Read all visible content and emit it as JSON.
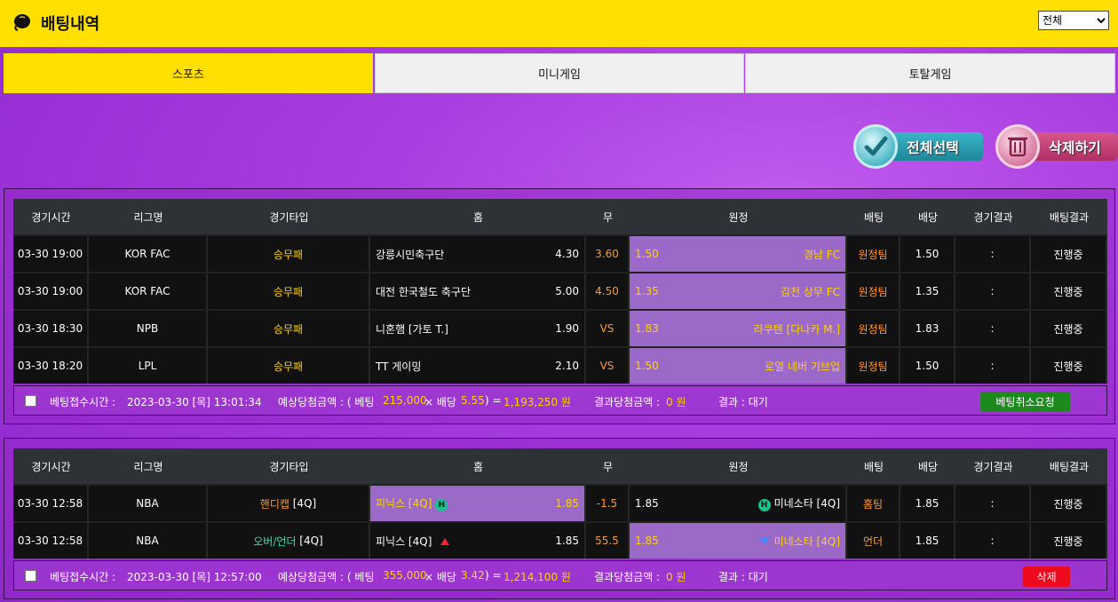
{
  "header": {
    "title": "배팅내역",
    "filter_selected": "전체"
  },
  "tabs": [
    "스포츠",
    "미니게임",
    "토탈게임"
  ],
  "actions": {
    "select_all": "전체선택",
    "delete": "삭제하기"
  },
  "columns": [
    "경기시간",
    "리그명",
    "경기타입",
    "홈",
    "무",
    "원정",
    "배팅",
    "배당",
    "경기결과",
    "배팅결과"
  ],
  "bets": [
    {
      "rows": [
        {
          "time": "03-30 19:00",
          "league": "KOR FAC",
          "type": "승무패",
          "type_extra": "",
          "home": "강릉시민축구단",
          "home_odds": "4.30",
          "draw": "3.60",
          "away_odds": "1.50",
          "away": "경남 FC",
          "pick": "원정팀",
          "odds": "1.50",
          "score": ":",
          "result": "진행중"
        },
        {
          "time": "03-30 19:00",
          "league": "KOR FAC",
          "type": "승무패",
          "type_extra": "",
          "home": "대전 한국철도 축구단",
          "home_odds": "5.00",
          "draw": "4.50",
          "away_odds": "1.35",
          "away": "김천 상무 FC",
          "pick": "원정팀",
          "odds": "1.35",
          "score": ":",
          "result": "진행중"
        },
        {
          "time": "03-30 18:30",
          "league": "NPB",
          "type": "승무패",
          "type_extra": "",
          "home": "니혼햄 [가토 T.]",
          "home_odds": "1.90",
          "draw": "VS",
          "away_odds": "1.83",
          "away": "라쿠텐 [다나카 M.]",
          "pick": "원정팀",
          "odds": "1.83",
          "score": ":",
          "result": "진행중"
        },
        {
          "time": "03-30 18:20",
          "league": "LPL",
          "type": "승무패",
          "type_extra": "",
          "home": "TT 게이밍",
          "home_odds": "2.10",
          "draw": "VS",
          "away_odds": "1.50",
          "away": "로열 네버 기브업",
          "pick": "원정팀",
          "odds": "1.50",
          "score": ":",
          "result": "진행중"
        }
      ],
      "summary": {
        "time_label": "베팅접수시간 :",
        "time": "2023-03-30 [목] 13:01:34",
        "expected_label": "예상당첨금액 : ( 베팅",
        "stake": "215,000",
        "times": "× 배당",
        "total_odds": "5.55",
        "eq": ") =",
        "expected": "1,193,250 원",
        "win_label": "결과당첨금액 :",
        "win": "0 원",
        "result_label": "결과 : 대기",
        "button": "베팅취소요청"
      }
    },
    {
      "rows": [
        {
          "time": "03-30 12:58",
          "league": "NBA",
          "type": "핸디캡",
          "type_extra": "[4Q]",
          "home": "피닉스 [4Q]",
          "home_odds": "1.85",
          "draw": "-1.5",
          "away_odds": "1.85",
          "away": "미네소타 [4Q]",
          "pick": "홈팀",
          "odds": "1.85",
          "score": ":",
          "result": "진행중"
        },
        {
          "time": "03-30 12:58",
          "league": "NBA",
          "type": "오버/언더",
          "type_extra": "[4Q]",
          "home": "피닉스 [4Q]",
          "home_odds": "1.85",
          "draw": "55.5",
          "away_odds": "1.85",
          "away": "미네소타 [4Q]",
          "pick": "언더",
          "odds": "1.85",
          "score": ":",
          "result": "진행중"
        }
      ],
      "summary": {
        "time_label": "베팅접수시간 :",
        "time": "2023-03-30 [목] 12:57:00",
        "expected_label": "예상당첨금액 : ( 베팅",
        "stake": "355,000",
        "times": "× 배당",
        "total_odds": "3.42",
        "eq": ") =",
        "expected": "1,214,100 원",
        "win_label": "결과당첨금액 :",
        "win": "0 원",
        "result_label": "결과 : 대기",
        "button": "삭제"
      }
    }
  ],
  "handicap_badge": "H",
  "colors": {
    "yellow": "#ffe000",
    "gold_text": "#ffd200",
    "orange_text": "#ff9a2a",
    "purple_cell": "#9b6ac9",
    "cancel_btn": "#1e8a1e",
    "delete_btn": "#ee0a1e"
  }
}
